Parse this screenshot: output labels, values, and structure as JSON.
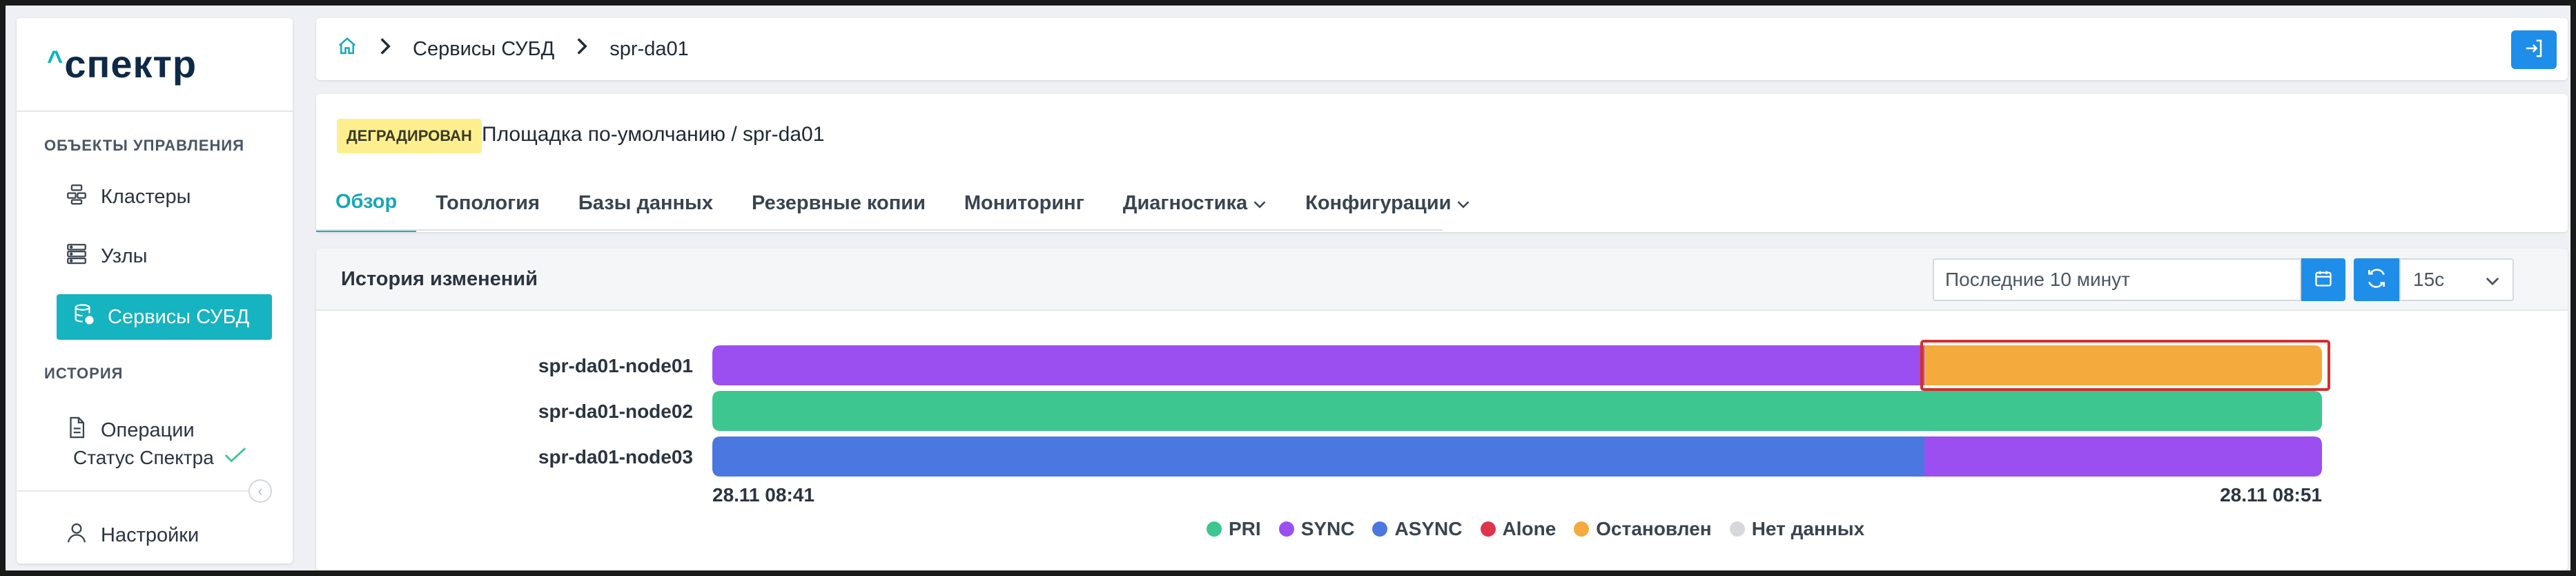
{
  "sidebar": {
    "logo_caret": "^",
    "logo_word": "спектр",
    "section_objects": "ОБЪЕКТЫ УПРАВЛЕНИЯ",
    "items": [
      {
        "label": "Кластеры",
        "icon": "clusters-icon"
      },
      {
        "label": "Узлы",
        "icon": "nodes-icon"
      },
      {
        "label": "Сервисы СУБД",
        "icon": "database-icon",
        "active": true
      }
    ],
    "section_history": "ИСТОРИЯ",
    "history_items": [
      {
        "label": "Операции",
        "icon": "document-icon"
      }
    ],
    "status_label": "Статус Спектра",
    "settings_label": "Настройки"
  },
  "breadcrumb": {
    "home_icon": "home-icon",
    "items": [
      "Сервисы СУБД",
      "spr-da01"
    ]
  },
  "header": {
    "badge": "ДЕГРАДИРОВАН",
    "place": "Площадка по-умолчанию /  spr-da01",
    "tabs": [
      {
        "label": "Обзор",
        "active": true
      },
      {
        "label": "Топология"
      },
      {
        "label": "Базы данных"
      },
      {
        "label": "Резервные копии"
      },
      {
        "label": "Мониторинг"
      },
      {
        "label": "Диагностика",
        "dropdown": true
      },
      {
        "label": "Конфигурации",
        "dropdown": true
      }
    ]
  },
  "history": {
    "title": "История изменений",
    "period_value": "Последние 10 минут",
    "interval_value": "15с"
  },
  "colors": {
    "PRI": "#3dc690",
    "SYNC": "#9b4ff0",
    "ASYNC": "#4a78e0",
    "Alone": "#e0344e",
    "Stopped": "#f4aa3c",
    "NoData": "#d6d8dc",
    "accent": "#16b3c0",
    "highlight": "#d32f2f"
  },
  "chart_data": {
    "type": "timeline",
    "x_start": "28.11 08:41",
    "x_end": "28.11 08:51",
    "rows": [
      {
        "name": "spr-da01-node01",
        "segments": [
          {
            "state": "SYNC",
            "from": 0,
            "to": 0.753
          },
          {
            "state": "Остановлен",
            "from": 0.753,
            "to": 1.0
          }
        ]
      },
      {
        "name": "spr-da01-node02",
        "segments": [
          {
            "state": "PRI",
            "from": 0,
            "to": 1.0
          }
        ]
      },
      {
        "name": "spr-da01-node03",
        "segments": [
          {
            "state": "ASYNC",
            "from": 0,
            "to": 0.753
          },
          {
            "state": "SYNC",
            "from": 0.753,
            "to": 1.0
          }
        ]
      }
    ],
    "legend": [
      {
        "label": "PRI",
        "color": "#3dc690"
      },
      {
        "label": "SYNC",
        "color": "#9b4ff0"
      },
      {
        "label": "ASYNC",
        "color": "#4a78e0"
      },
      {
        "label": "Alone",
        "color": "#e0344e"
      },
      {
        "label": "Остановлен",
        "color": "#f4aa3c"
      },
      {
        "label": "Нет данных",
        "color": "#d6d8dc"
      }
    ],
    "highlighted_segment": {
      "row": 0,
      "segment": 1
    }
  }
}
